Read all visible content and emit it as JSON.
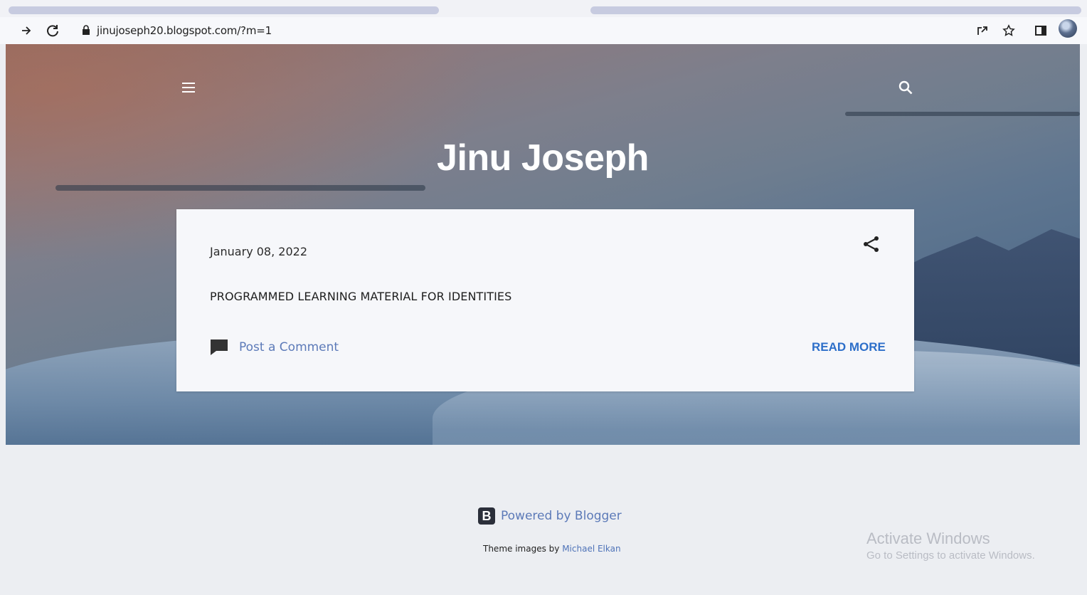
{
  "browser": {
    "url": "jinujoseph20.blogspot.com/?m=1"
  },
  "blog": {
    "title": "Jinu Joseph"
  },
  "post": {
    "date": "January 08, 2022",
    "title": "PROGRAMMED LEARNING MATERIAL FOR IDENTITIES",
    "comment_link": "Post a Comment",
    "read_more": "READ MORE"
  },
  "footer": {
    "powered_by": "Powered by Blogger",
    "blogger_logo_letter": "B",
    "theme_credit_prefix": "Theme images by",
    "theme_credit_author": "Michael Elkan"
  },
  "watermark": {
    "title": "Activate Windows",
    "subtitle": "Go to Settings to activate Windows."
  },
  "icons": [
    "forward-icon",
    "reload-icon",
    "lock-icon",
    "share-page-icon",
    "bookmark-star-icon",
    "side-panel-icon",
    "profile-avatar",
    "menu-icon",
    "search-icon",
    "share-icon",
    "comment-icon"
  ]
}
